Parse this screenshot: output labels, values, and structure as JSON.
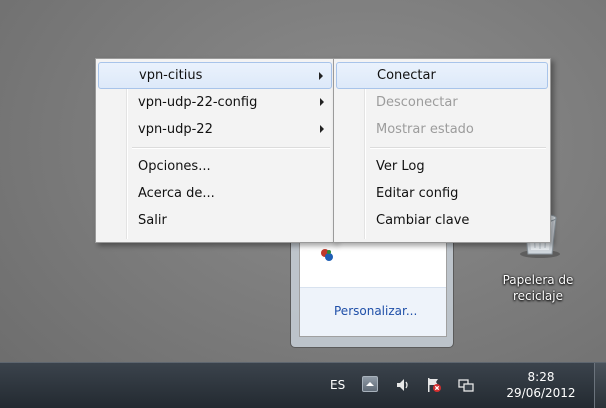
{
  "main_menu": {
    "items": [
      {
        "label": "vpn-citius",
        "submenu": true,
        "hover": true
      },
      {
        "label": "vpn-udp-22-config",
        "submenu": true
      },
      {
        "label": "vpn-udp-22",
        "submenu": true
      }
    ],
    "options_label": "Opciones...",
    "about_label": "Acerca de...",
    "exit_label": "Salir"
  },
  "sub_menu": {
    "connect_label": "Conectar",
    "disconnect_label": "Desconectar",
    "show_status_label": "Mostrar estado",
    "view_log_label": "Ver Log",
    "edit_config_label": "Editar config",
    "change_password_label": "Cambiar clave"
  },
  "tray_popup": {
    "customize_label": "Personalizar..."
  },
  "desktop": {
    "recycle_bin_line1": "Papelera de",
    "recycle_bin_line2": "reciclaje"
  },
  "taskbar": {
    "language": "ES",
    "time": "8:28",
    "date": "29/06/2012",
    "icons": [
      "show-hidden-icons",
      "volume-icon",
      "action-center-flag-icon",
      "network-icon"
    ]
  },
  "colors": {
    "menu_background": "#f3f3f3",
    "hover_highlight": "#dde9f9",
    "disabled_text": "#9c9c9c",
    "link_blue": "#1f4fa8",
    "taskbar": "#2b3238"
  }
}
